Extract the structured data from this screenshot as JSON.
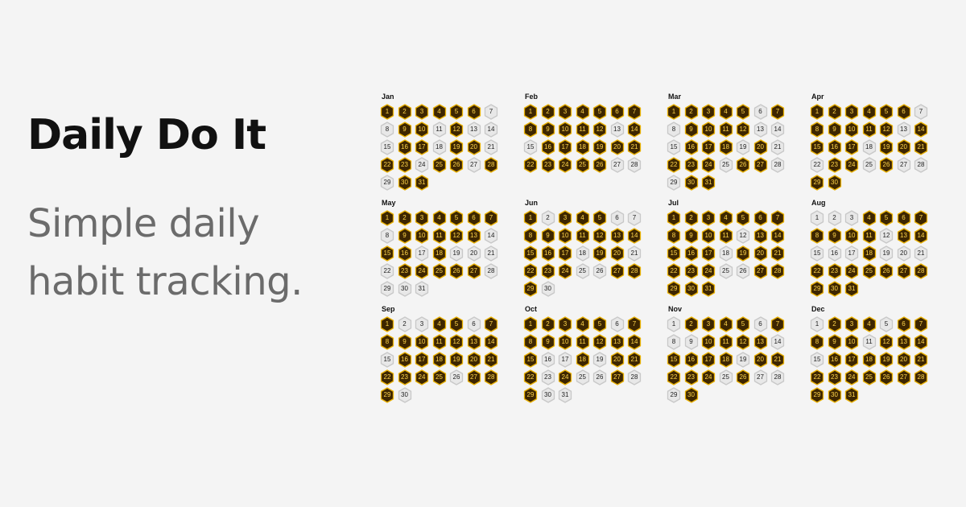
{
  "hero": {
    "title": "Daily Do It",
    "tagline": "Simple daily habit tracking."
  },
  "colors": {
    "background": "#f4f4f4",
    "done_fill": "#3d2600",
    "done_stroke": "#e8b000",
    "done_text": "#ffd54a",
    "todo_fill": "#e8e8e8",
    "todo_stroke": "#c8c8c8",
    "todo_text": "#222222"
  },
  "months": [
    {
      "name": "Jan",
      "days": 31,
      "done": [
        1,
        2,
        3,
        4,
        5,
        6,
        9,
        10,
        12,
        16,
        17,
        19,
        20,
        22,
        23,
        25,
        26,
        28,
        30,
        31
      ]
    },
    {
      "name": "Feb",
      "days": 28,
      "done": [
        1,
        2,
        3,
        4,
        5,
        6,
        7,
        8,
        9,
        10,
        11,
        12,
        14,
        16,
        17,
        18,
        19,
        20,
        21,
        22,
        23,
        24,
        25,
        26
      ]
    },
    {
      "name": "Mar",
      "days": 31,
      "done": [
        1,
        2,
        3,
        4,
        5,
        7,
        9,
        10,
        11,
        12,
        16,
        17,
        18,
        20,
        22,
        23,
        24,
        26,
        27,
        30,
        31
      ]
    },
    {
      "name": "Apr",
      "days": 30,
      "done": [
        1,
        2,
        3,
        4,
        5,
        6,
        8,
        9,
        10,
        11,
        12,
        14,
        15,
        16,
        17,
        19,
        20,
        21,
        23,
        24,
        26,
        29,
        30
      ]
    },
    {
      "name": "May",
      "days": 31,
      "done": [
        1,
        2,
        3,
        4,
        5,
        6,
        7,
        9,
        10,
        11,
        12,
        13,
        15,
        16,
        18,
        23,
        24,
        25,
        26,
        27
      ]
    },
    {
      "name": "Jun",
      "days": 30,
      "done": [
        1,
        3,
        4,
        5,
        8,
        9,
        10,
        11,
        12,
        13,
        14,
        15,
        16,
        17,
        19,
        20,
        22,
        23,
        24,
        27,
        28,
        29
      ]
    },
    {
      "name": "Jul",
      "days": 31,
      "done": [
        1,
        2,
        3,
        4,
        5,
        6,
        7,
        8,
        9,
        10,
        11,
        13,
        14,
        15,
        16,
        17,
        19,
        20,
        21,
        22,
        23,
        24,
        27,
        28,
        29,
        30,
        31
      ]
    },
    {
      "name": "Aug",
      "days": 31,
      "done": [
        4,
        5,
        6,
        7,
        8,
        9,
        10,
        11,
        13,
        14,
        18,
        22,
        23,
        24,
        25,
        26,
        27,
        28,
        29,
        30,
        31
      ]
    },
    {
      "name": "Sep",
      "days": 30,
      "done": [
        1,
        4,
        5,
        7,
        8,
        9,
        10,
        11,
        12,
        13,
        14,
        16,
        17,
        18,
        19,
        20,
        21,
        22,
        23,
        24,
        25,
        27,
        28,
        29
      ]
    },
    {
      "name": "Oct",
      "days": 31,
      "done": [
        1,
        2,
        3,
        4,
        5,
        7,
        8,
        9,
        10,
        11,
        12,
        13,
        14,
        15,
        18,
        20,
        21,
        22,
        24,
        27,
        29
      ]
    },
    {
      "name": "Nov",
      "days": 30,
      "done": [
        2,
        3,
        4,
        5,
        7,
        10,
        11,
        12,
        13,
        15,
        16,
        17,
        18,
        20,
        21,
        22,
        23,
        24,
        26,
        30
      ]
    },
    {
      "name": "Dec",
      "days": 31,
      "done": [
        2,
        3,
        4,
        6,
        7,
        8,
        9,
        10,
        12,
        13,
        14,
        16,
        17,
        18,
        19,
        20,
        21,
        22,
        23,
        24,
        25,
        26,
        27,
        28,
        29,
        30,
        31
      ]
    }
  ]
}
